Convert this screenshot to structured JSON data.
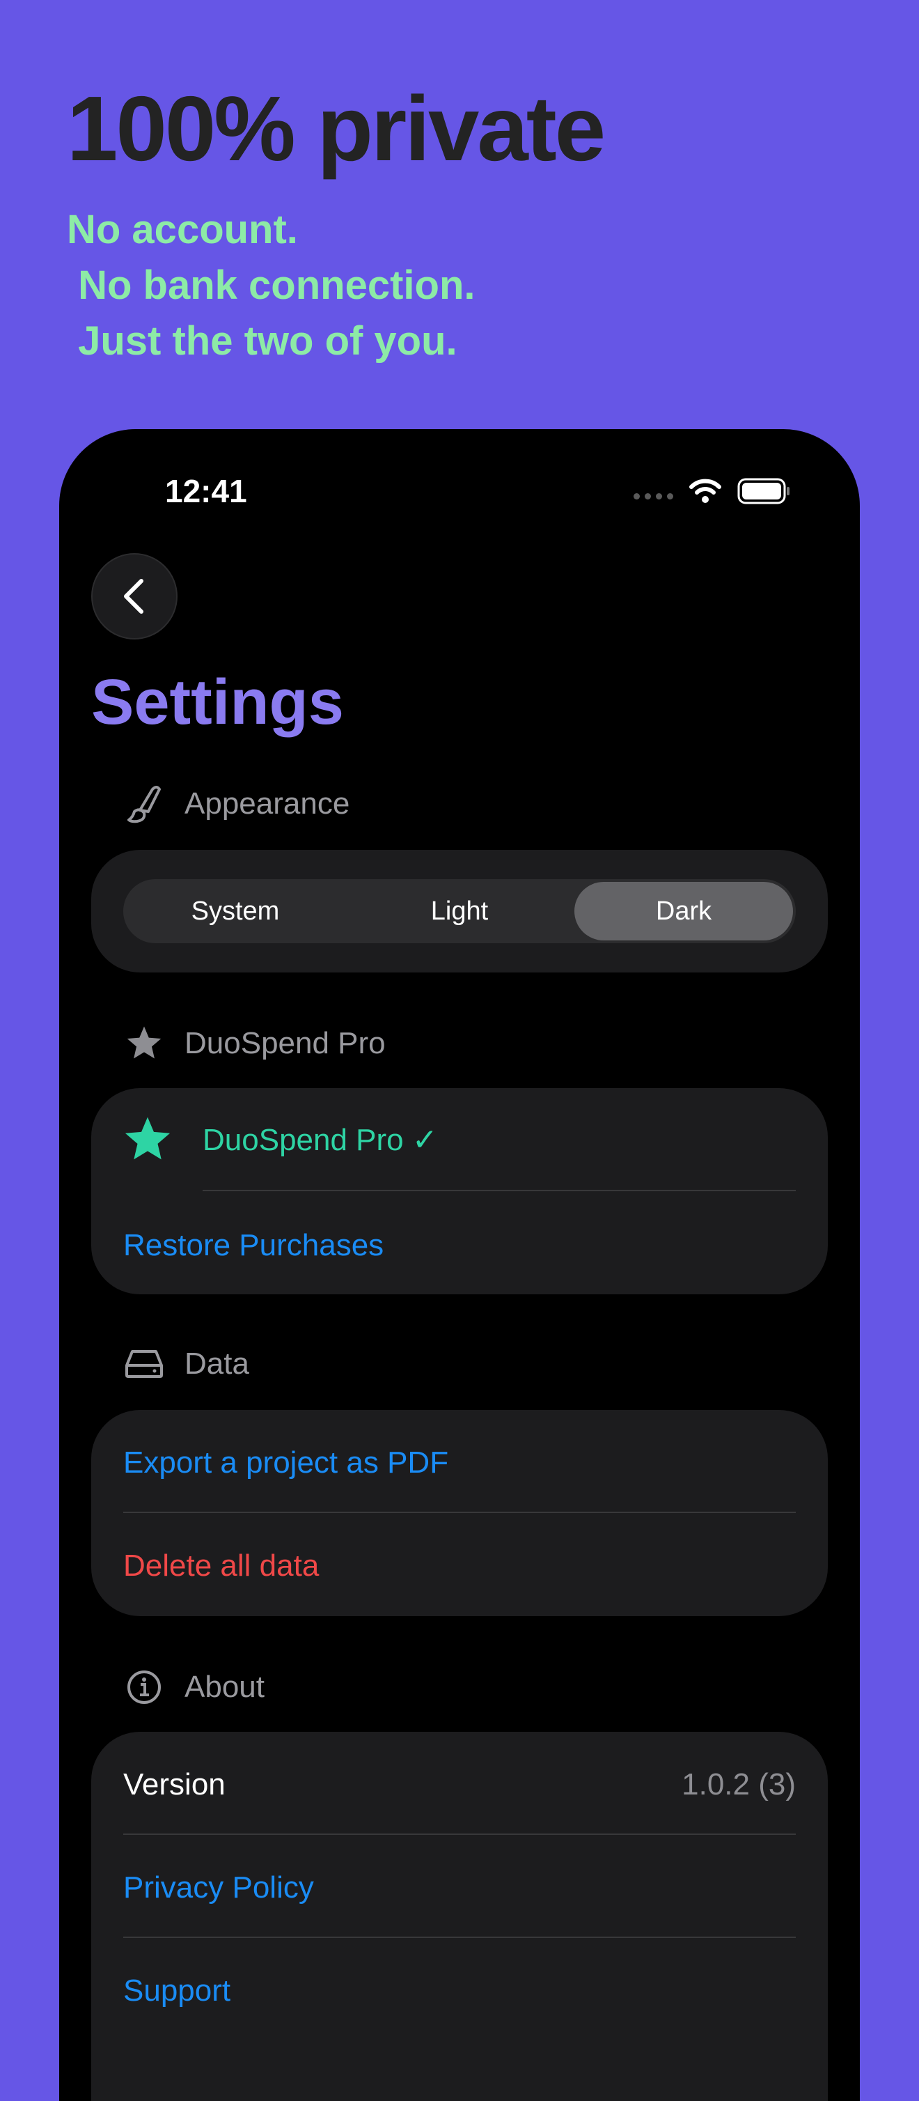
{
  "promo": {
    "headline": "100% private",
    "lines": [
      "No account.",
      " No bank connection.",
      " Just the two of you."
    ]
  },
  "status_bar": {
    "time": "12:41"
  },
  "nav": {
    "title": "Settings"
  },
  "appearance": {
    "header": "Appearance",
    "options": [
      "System",
      "Light",
      "Dark"
    ],
    "selected": "Dark"
  },
  "pro": {
    "header": "DuoSpend Pro",
    "status_label": "DuoSpend Pro ✓",
    "restore_label": "Restore Purchases"
  },
  "data_section": {
    "header": "Data",
    "export_label": "Export a project as PDF",
    "delete_label": "Delete all data"
  },
  "about": {
    "header": "About",
    "version_label": "Version",
    "version_value": "1.0.2 (3)",
    "privacy_label": "Privacy Policy",
    "support_label": "Support"
  },
  "colors": {
    "background": "#6656E6",
    "headline": "#232323",
    "tagline": "#8DEBA6",
    "title": "#8A7BF0",
    "link": "#1A8CF5",
    "destructive": "#F04848",
    "pro_accent": "#2ED4A4"
  }
}
